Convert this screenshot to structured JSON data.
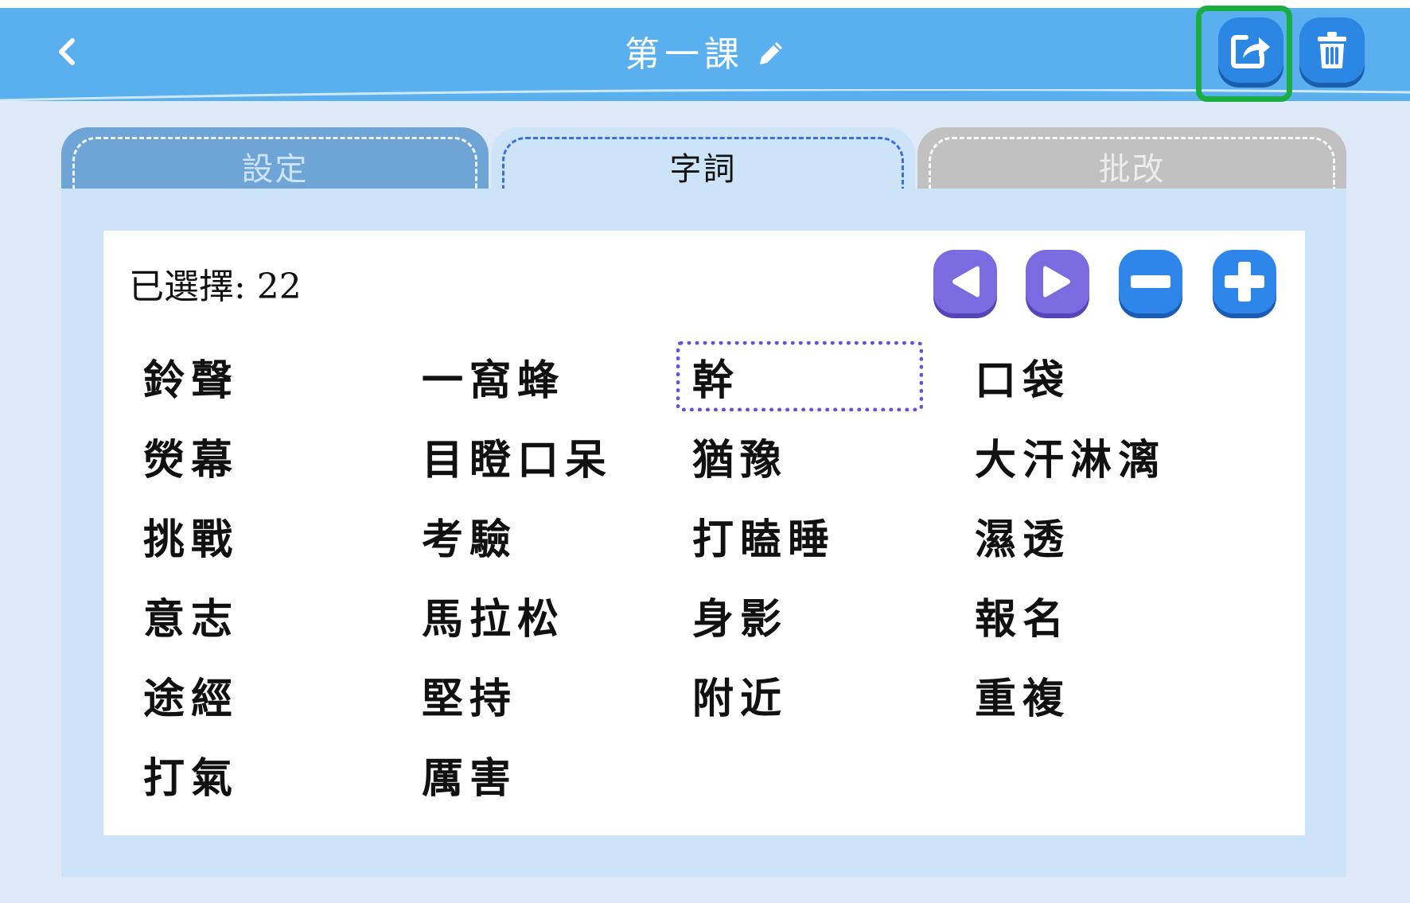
{
  "header": {
    "title": "第一課",
    "back_icon": "chevron-left-icon",
    "edit_icon": "pencil-icon",
    "share_icon": "share-icon",
    "delete_icon": "trash-icon",
    "colors": {
      "header_bg": "#5aafee",
      "button_bg": "#2b86e4",
      "highlight": "#1aad3f"
    }
  },
  "tabs": [
    {
      "label": "設定",
      "active": false
    },
    {
      "label": "字詞",
      "active": true
    },
    {
      "label": "批改",
      "active": false
    }
  ],
  "selection": {
    "label": "已選擇: 22"
  },
  "controls": {
    "prev_icon": "triangle-left-icon",
    "next_icon": "triangle-right-icon",
    "remove_icon": "minus-icon",
    "add_icon": "plus-icon",
    "colors": {
      "nav": "#7b6be0",
      "edit": "#2f86ea"
    }
  },
  "words": [
    "鈴聲",
    "一窩蜂",
    "幹",
    "口袋",
    "熒幕",
    "目瞪口呆",
    "猶豫",
    "大汗淋漓",
    "挑戰",
    "考驗",
    "打瞌睡",
    "濕透",
    "意志",
    "馬拉松",
    "身影",
    "報名",
    "途經",
    "堅持",
    "附近",
    "重複",
    "打氣",
    "厲害"
  ],
  "highlighted_word": "幹"
}
